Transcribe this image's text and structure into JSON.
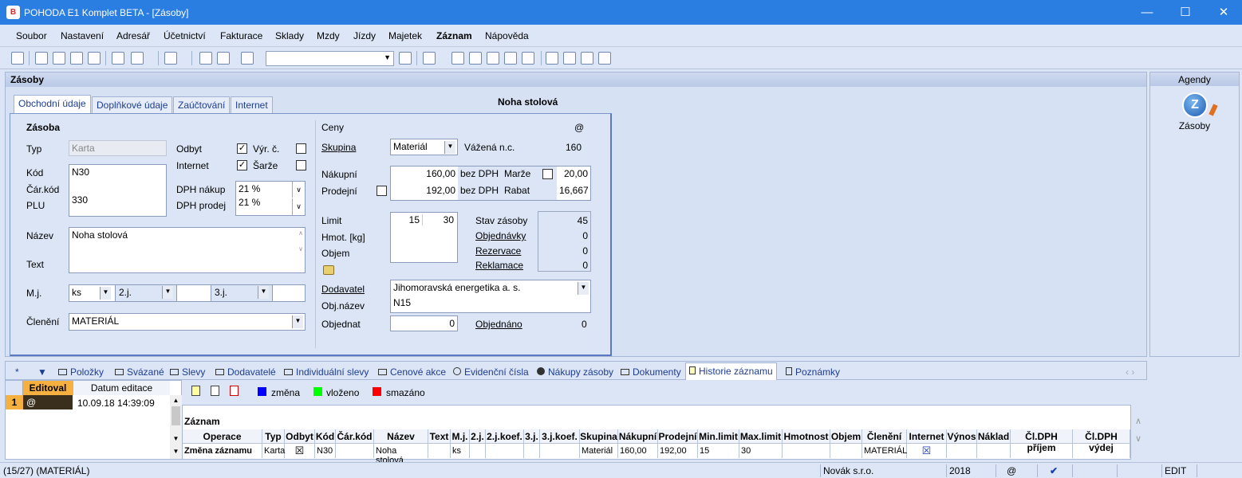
{
  "window": {
    "title": "POHODA E1 Komplet BETA - [Zásoby]",
    "icon": "pohoda-logo-icon"
  },
  "menu": [
    "Soubor",
    "Nastavení",
    "Adresář",
    "Účetnictví",
    "Fakturace",
    "Sklady",
    "Mzdy",
    "Jízdy",
    "Majetek",
    "Záznam",
    "Nápověda"
  ],
  "panel": {
    "title": "Zásoby",
    "tabs": [
      "Obchodní údaje",
      "Doplňkové údaje",
      "Zaúčtování",
      "Internet"
    ],
    "record_title": "Noha stolová"
  },
  "zasoba": {
    "heading": "Zásoba",
    "typ_label": "Typ",
    "typ_value": "Karta",
    "odbyt_label": "Odbyt",
    "vyrc_label": "Výr. č.",
    "internet_label": "Internet",
    "sarze_label": "Šarže",
    "kod_label": "Kód",
    "kod_value": "N30",
    "carkod_label": "Čár.kód",
    "plu_label": "PLU",
    "plu_value": "330",
    "dph_nakup_label": "DPH nákup",
    "dph_nakup_value": "21 %",
    "dph_prodej_label": "DPH prodej",
    "dph_prodej_value": "21 %",
    "nazev_label": "Název",
    "nazev_value": "Noha stolová",
    "text_label": "Text",
    "mj_label": "M.j.",
    "mj_value": "ks",
    "j2_label": "2.j.",
    "j3_label": "3.j.",
    "cleneni_label": "Členění",
    "cleneni_value": "MATERIÁL"
  },
  "ceny": {
    "heading": "Ceny",
    "at": "@",
    "skupina_label": "Skupina",
    "skupina_value": "Materiál",
    "vazena_label": "Vážená n.c.",
    "vazena_value": "160",
    "nakupni_label": "Nákupní",
    "nakupni_value": "160,00",
    "bezdph1": "bez DPH",
    "marze_label": "Marže",
    "marze_value": "20,00",
    "prodejni_label": "Prodejní",
    "prodejni_value": "192,00",
    "bezdph2": "bez DPH",
    "rabat_label": "Rabat",
    "rabat_value": "16,667",
    "limit_label": "Limit",
    "limit_min": "15",
    "limit_max": "30",
    "hmot_label": "Hmot. [kg]",
    "objem_label": "Objem",
    "stav_label": "Stav zásoby",
    "stav_value": "45",
    "objednavky_label": "Objednávky",
    "objednavky_value": "0",
    "rezervace_label": "Rezervace",
    "rezervace_value": "0",
    "reklamace_label": "Reklamace",
    "reklamace_value": "0",
    "dodavatel_label": "Dodavatel",
    "dodavatel_value": "Jihomoravská energetika a. s.",
    "objnazev_label": "Obj.název",
    "objnazev_value": "N15",
    "objednat_label": "Objednat",
    "objednat_value": "0",
    "objednano_label": "Objednáno",
    "objednano_value": "0"
  },
  "agendy": {
    "title": "Agendy",
    "item": "Zásoby"
  },
  "bottom_tabs": [
    "*",
    "Položky",
    "Svázané",
    "Slevy",
    "Dodavatelé",
    "Individuální slevy",
    "Cenové akce",
    "Evidenční čísla",
    "Nákupy zásoby",
    "Dokumenty",
    "Historie záznamu",
    "Poznámky"
  ],
  "left_grid": {
    "col1": "Editoval",
    "col2": "Datum editace",
    "row_num": "1",
    "row_user": "@",
    "row_date": "10.09.18 14:39:09"
  },
  "legend": {
    "zmena": "změna",
    "vlozeno": "vloženo",
    "smazano": "smazáno",
    "colors": {
      "zmena": "#0000ff",
      "vlozeno": "#00ff00",
      "smazano": "#ff0000"
    }
  },
  "history": {
    "title": "Záznam",
    "headers": [
      "Operace",
      "Typ",
      "Odbyt",
      "Kód",
      "Čár.kód",
      "Název",
      "Text",
      "M.j.",
      "2.j.",
      "2.j.koef.",
      "3.j.",
      "3.j.koef.",
      "Skupina",
      "Nákupní",
      "Prodejní",
      "Min.limit",
      "Max.limit",
      "Hmotnost",
      "Objem",
      "Členění",
      "Internet",
      "Výnos",
      "Náklad",
      "Čl.DPH příjem",
      "Čl.DPH výdej"
    ],
    "row": [
      "Změna záznamu",
      "Karta",
      "☒",
      "N30",
      "",
      "Noha stolová",
      "",
      "ks",
      "",
      "",
      "",
      "",
      "Materiál",
      "160,00",
      "192,00",
      "15",
      "30",
      "",
      "",
      "MATERIÁL",
      "☒",
      "",
      "",
      "",
      ""
    ]
  },
  "status": {
    "left": "(15/27) (MATERIÁL)",
    "company": "Novák s.r.o.",
    "year": "2018",
    "at": "@",
    "mode": "EDIT"
  }
}
